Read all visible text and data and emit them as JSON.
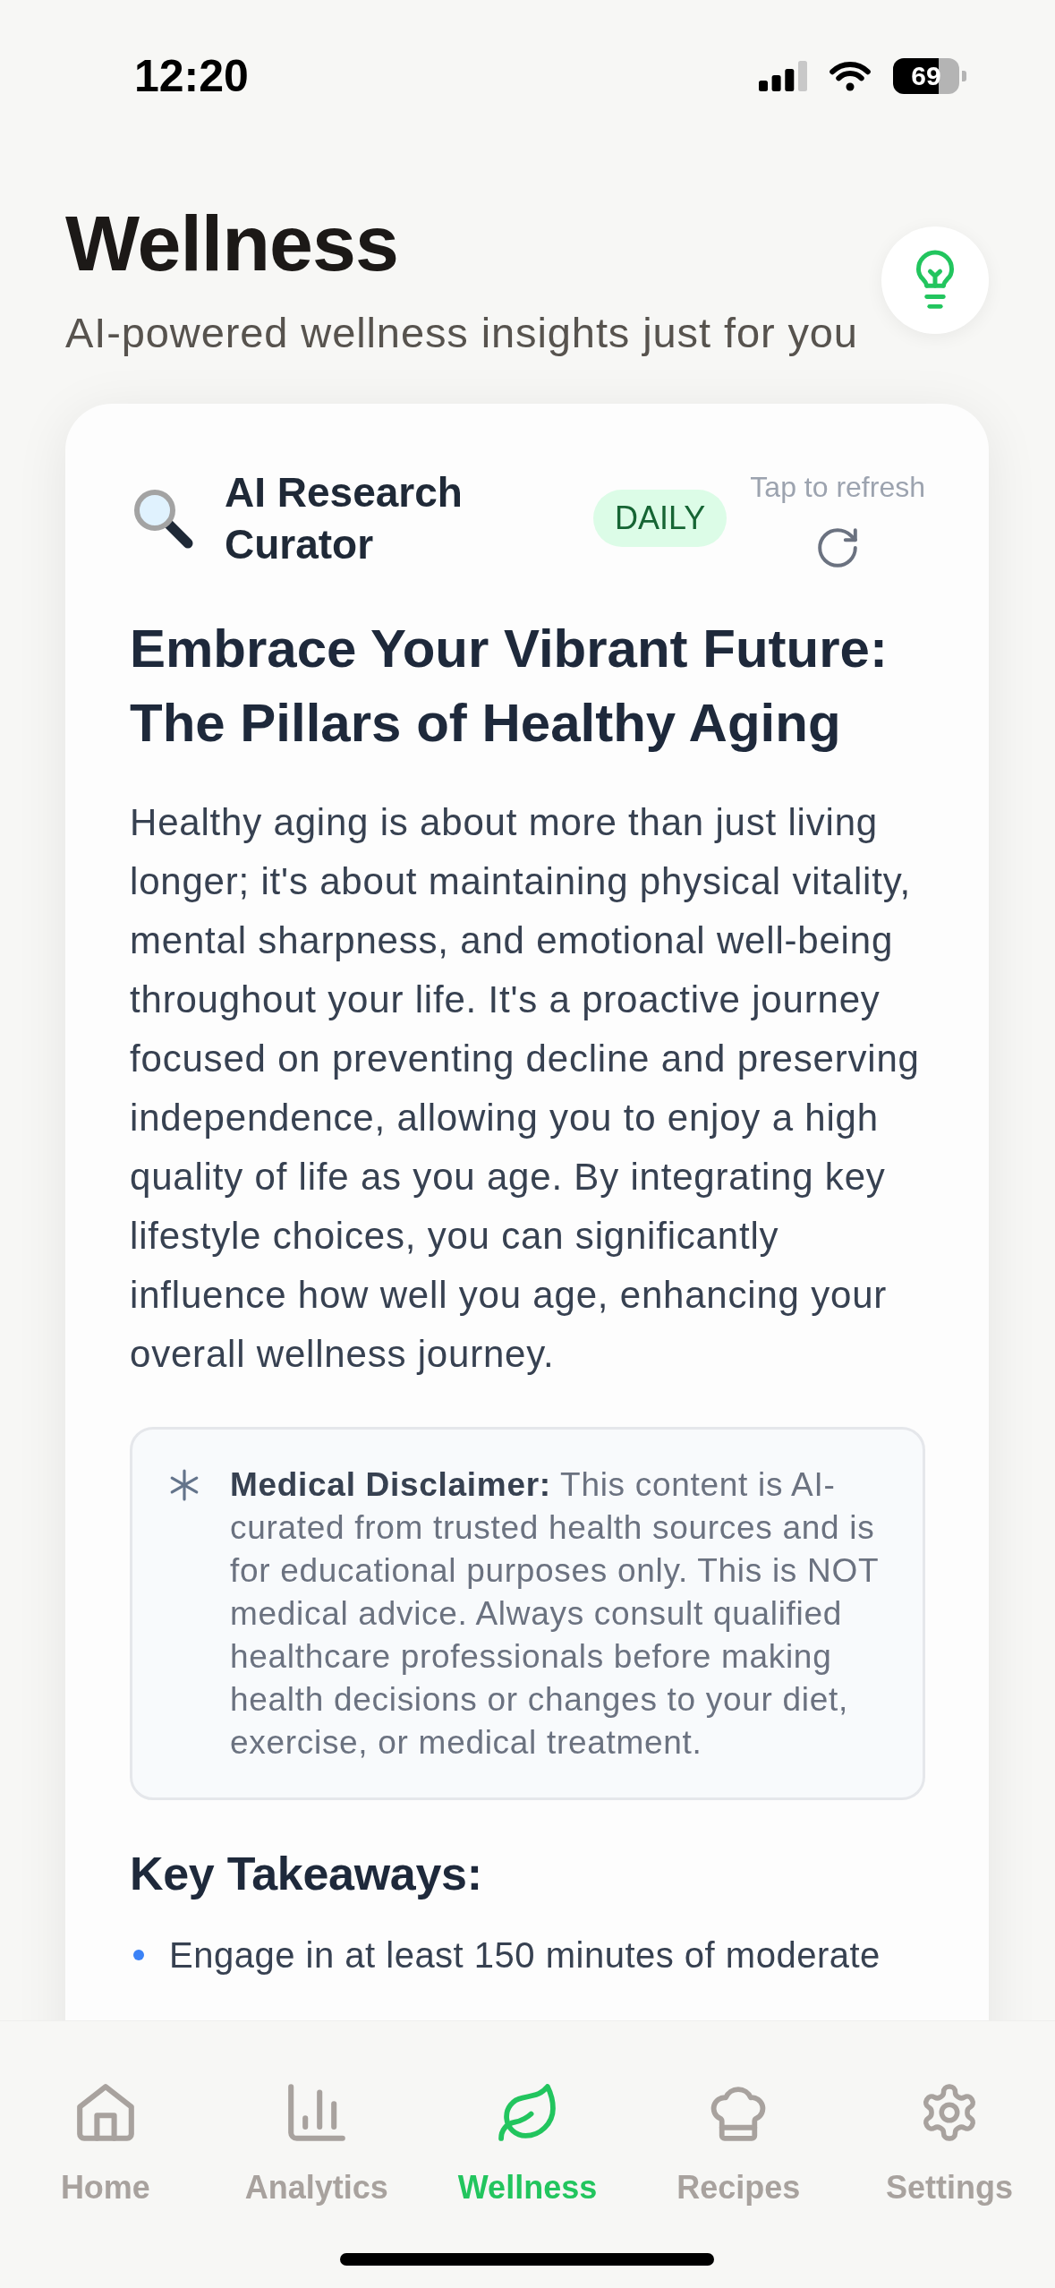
{
  "status_bar": {
    "time": "12:20",
    "battery": "69"
  },
  "header": {
    "title": "Wellness",
    "subtitle": "AI-powered wellness insights just for you"
  },
  "card": {
    "source": "AI Research Curator",
    "badge": "DAILY",
    "refresh_hint": "Tap to refresh",
    "title": "Embrace Your Vibrant Future: The Pillars of Healthy Aging",
    "body": "Healthy aging is about more than just living longer; it's about maintaining physical vitality, mental sharpness, and emotional well-being throughout your life. It's a proactive journey focused on preventing decline and preserving independence, allowing you to enjoy a high quality of life as you age. By integrating key lifestyle choices, you can significantly influence how well you age, enhancing your overall wellness journey.",
    "disclaimer": "**Medical Disclaimer:** This content is AI-curated from trusted health sources and is for educational purposes only. This is NOT medical advice. Always consult qualified healthcare professionals before making health decisions or changes to your diet, exercise, or medical treatment.",
    "section_title": "Key Takeaways:",
    "takeaways": [
      "Engage in at least 150 minutes of moderate"
    ]
  },
  "tab_bar": [
    {
      "label": "Home",
      "selected": false
    },
    {
      "label": "Analytics",
      "selected": false
    },
    {
      "label": "Wellness",
      "selected": true
    },
    {
      "label": "Recipes",
      "selected": false
    },
    {
      "label": "Settings",
      "selected": false
    }
  ]
}
